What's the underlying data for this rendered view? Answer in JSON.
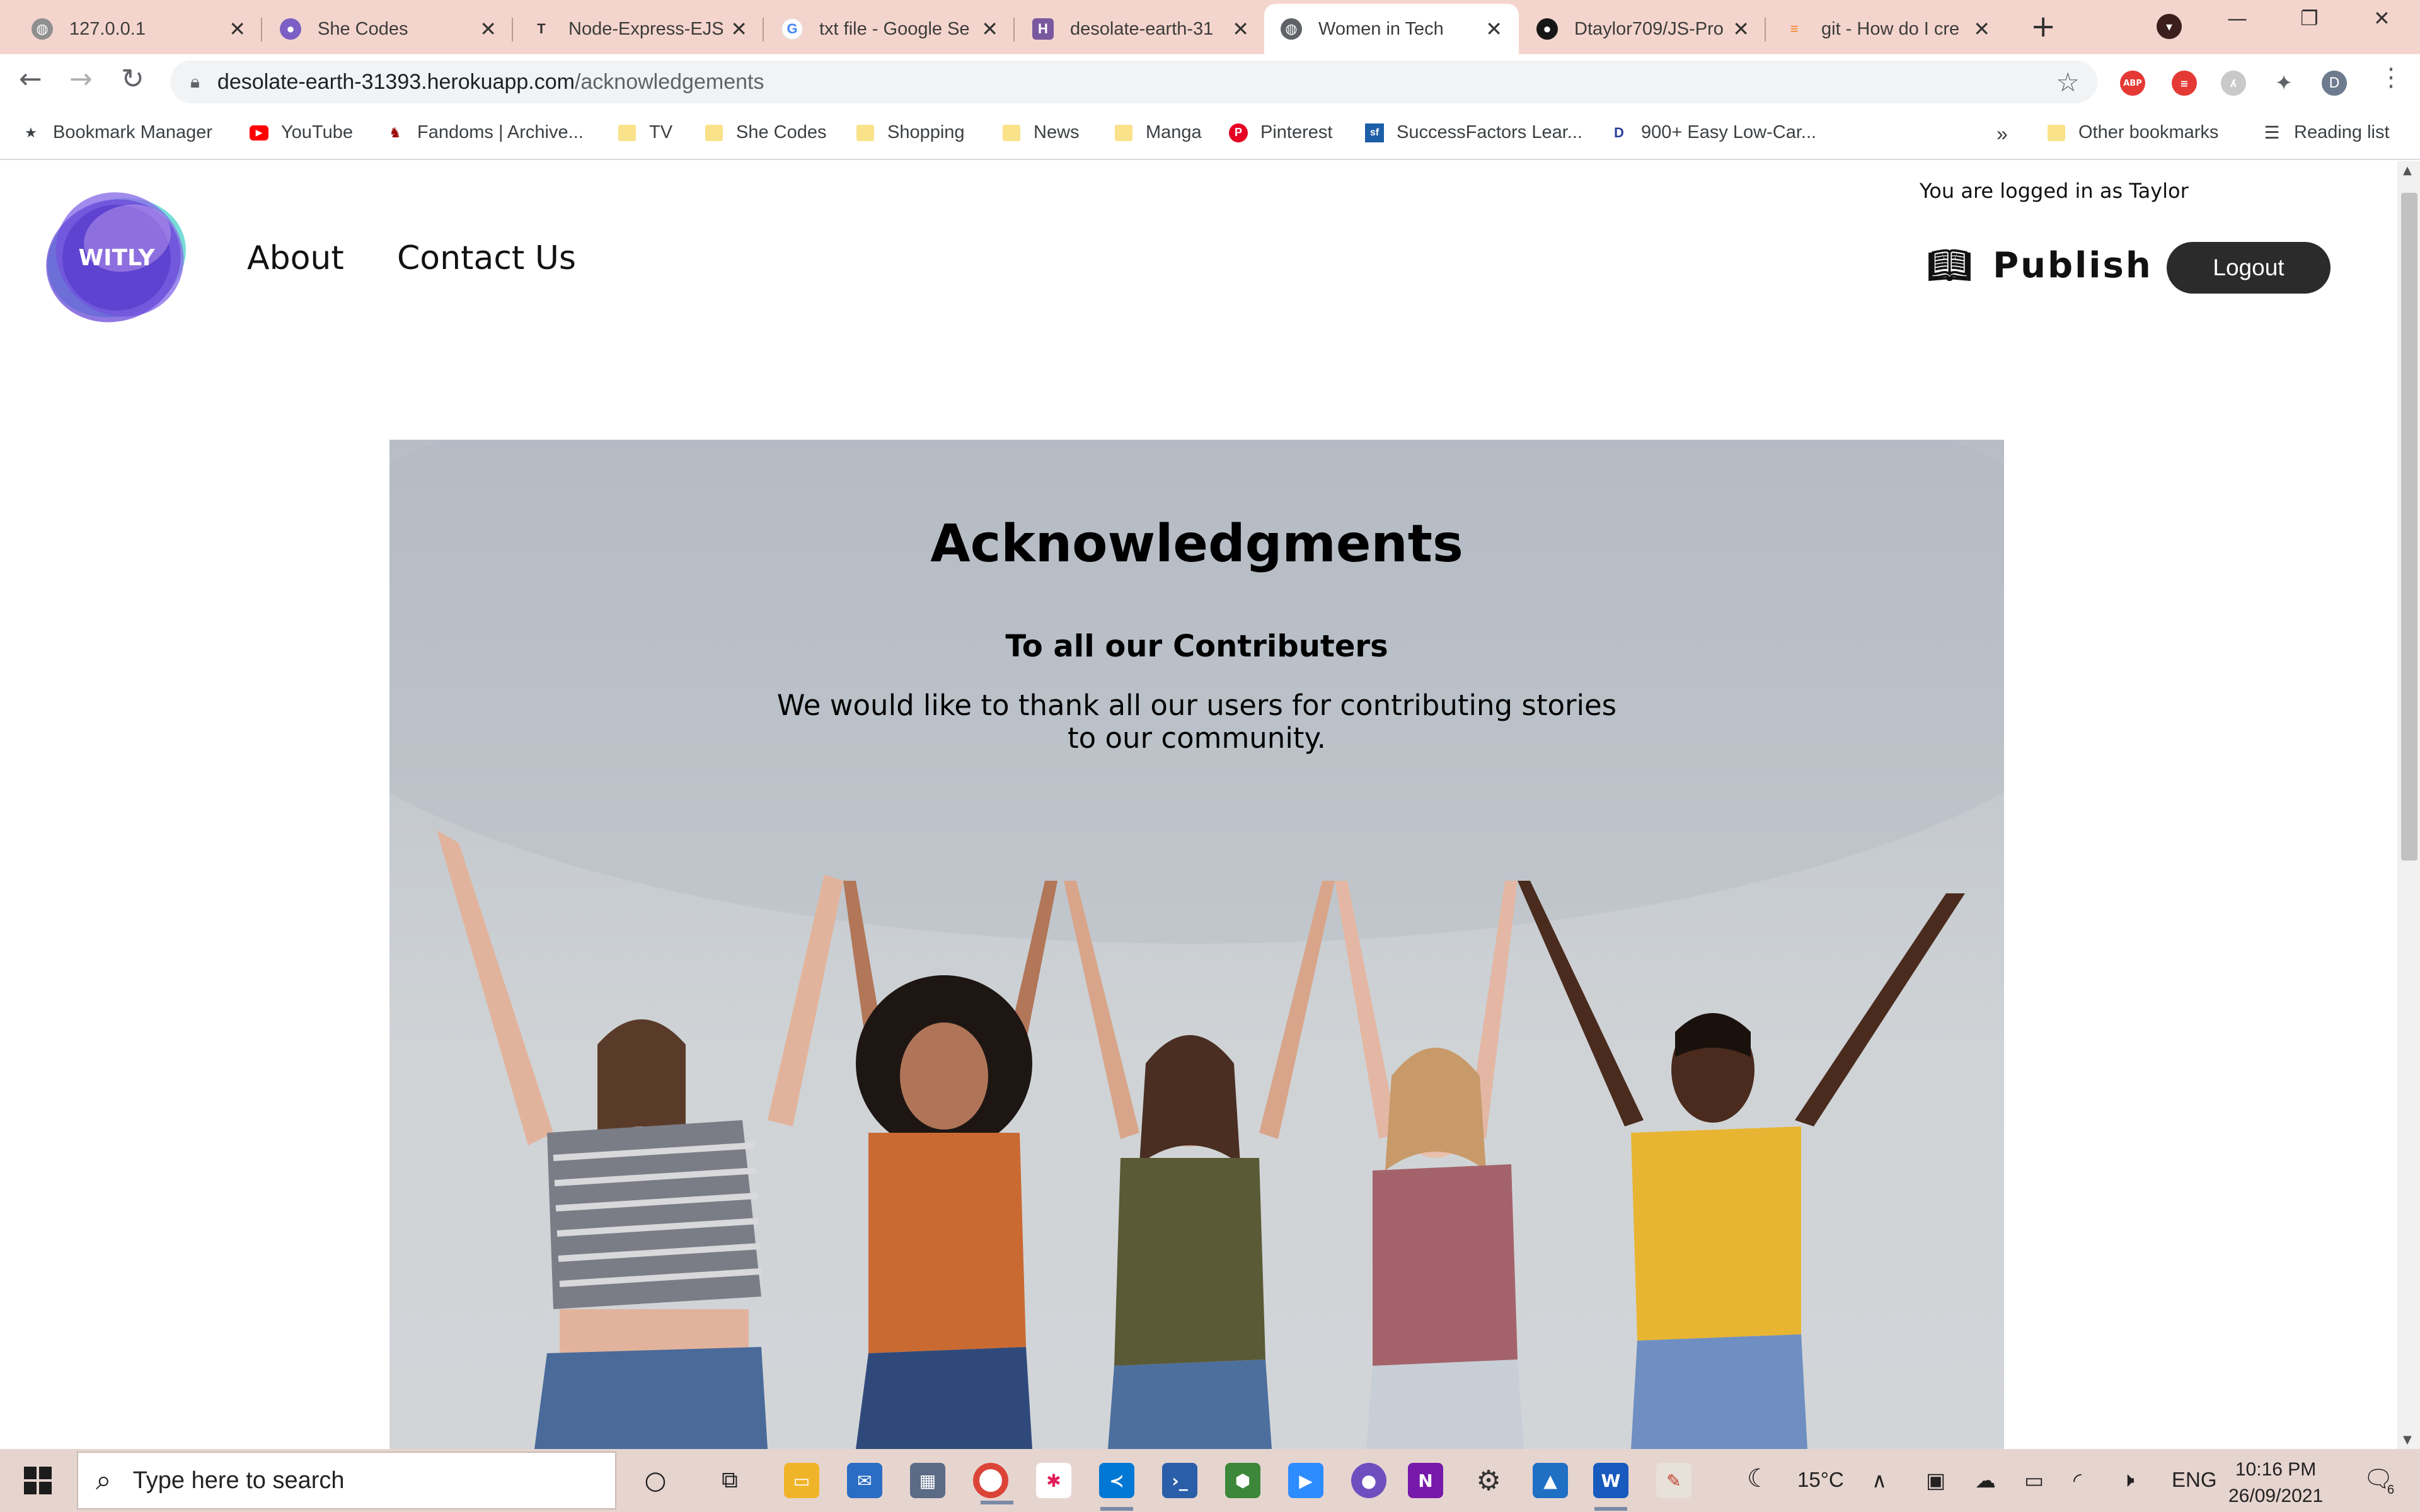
{
  "browser": {
    "tabs": [
      {
        "title": "127.0.0.1",
        "icon": "globe-icon",
        "color": "#8f8f8f"
      },
      {
        "title": "She Codes",
        "icon": "she-codes-icon",
        "color": "#7b5fc4"
      },
      {
        "title": "Node-Express-EJS",
        "icon": "text-t-icon",
        "color": "#333333"
      },
      {
        "title": "txt file - Google Se",
        "icon": "google-icon",
        "color": "#4285f4"
      },
      {
        "title": "desolate-earth-31",
        "icon": "heroku-icon",
        "color": "#79589f"
      },
      {
        "title": "Women in Tech",
        "icon": "globe-icon",
        "color": "#5f6368"
      },
      {
        "title": "Dtaylor709/JS-Pro",
        "icon": "github-icon",
        "color": "#181717"
      },
      {
        "title": "git - How do I cre",
        "icon": "stackoverflow-icon",
        "color": "#f48024"
      }
    ],
    "new_tab": "+",
    "url_host": "desolate-earth-31393.herokuapp.com",
    "url_path": "/acknowledgements",
    "profile_initial": "D",
    "extension_abp": "ABP",
    "bookmarks": [
      {
        "label": "Bookmark Manager",
        "icon": "star-icon"
      },
      {
        "label": "YouTube",
        "icon": "youtube-icon"
      },
      {
        "label": "Fandoms | Archive...",
        "icon": "ao3-icon"
      },
      {
        "label": "TV",
        "icon": "folder-icon"
      },
      {
        "label": "She Codes",
        "icon": "folder-icon"
      },
      {
        "label": "Shopping",
        "icon": "folder-icon"
      },
      {
        "label": "News",
        "icon": "folder-icon"
      },
      {
        "label": "Manga",
        "icon": "folder-icon"
      },
      {
        "label": "Pinterest",
        "icon": "pinterest-icon"
      },
      {
        "label": "SuccessFactors Lear...",
        "icon": "successfactors-icon"
      },
      {
        "label": "900+ Easy Low-Car...",
        "icon": "diet-doctor-icon"
      }
    ],
    "bookmarks_overflow": "»",
    "other_bookmarks": "Other bookmarks",
    "reading_list": "Reading list"
  },
  "site": {
    "logo_text": "WITLY",
    "nav": {
      "about": "About",
      "contact": "Contact Us"
    },
    "logged_in_text": "You are logged in as Taylor",
    "publish_label": "Publish",
    "logout_label": "Logout"
  },
  "hero": {
    "title": "Acknowledgments",
    "subtitle": "To all our Contributers",
    "body": "We would like to thank all our users for contributing stories to our community."
  },
  "taskbar": {
    "search_placeholder": "Type here to search",
    "temperature": "15°C",
    "language": "ENG",
    "time": "10:16 PM",
    "date": "26/09/2021",
    "notification_count": "6"
  }
}
